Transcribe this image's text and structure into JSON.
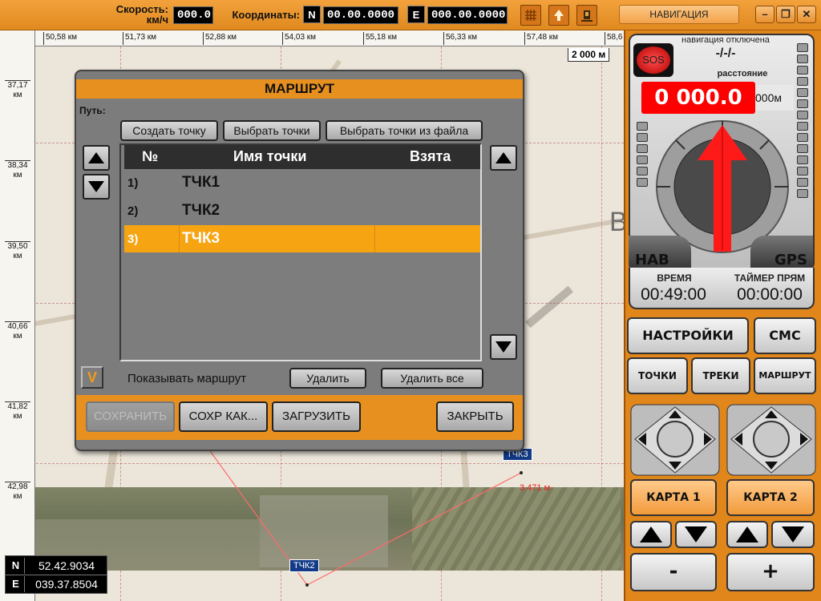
{
  "topbar": {
    "speed_label": "Скорость:",
    "speed_unit": "км/ч",
    "speed_value": "000.0",
    "coords_label": "Координаты:",
    "n_key": "N",
    "n_value": "00.00.0000",
    "e_key": "E",
    "e_value": "000.00.0000",
    "nav_tab": "НАВИГАЦИЯ"
  },
  "map": {
    "h_ticks": [
      "50,58 км",
      "51,73 км",
      "52,88 км",
      "54,03 км",
      "55,18 км",
      "56,33 км",
      "57,48 км",
      "58,6"
    ],
    "v_ticks": [
      {
        "top": "37,17",
        "bottom": "км"
      },
      {
        "top": "38,34",
        "bottom": "км"
      },
      {
        "top": "39,50",
        "bottom": "км"
      },
      {
        "top": "40,66",
        "bottom": "км"
      },
      {
        "top": "41,82",
        "bottom": "км"
      },
      {
        "top": "42,98",
        "bottom": "км"
      }
    ],
    "scale": "2 000 м",
    "marker1": "ТЧК3",
    "marker2": "ТЧК2",
    "distance": "3 471 м",
    "big_letter": "В",
    "n_key": "N",
    "n_value": "52.42.9034",
    "e_key": "E",
    "e_value": "039.37.8504"
  },
  "dialog": {
    "title": "МАРШРУТ",
    "path_label": "Путь:",
    "create_point": "Создать точку",
    "select_points": "Выбрать точки",
    "select_from_file": "Выбрать точки из файла",
    "col_num": "№",
    "col_name": "Имя точки",
    "col_taken": "Взята",
    "rows": [
      {
        "num": "1)",
        "name": "ТЧК1",
        "taken": ""
      },
      {
        "num": "2)",
        "name": "ТЧК2",
        "taken": ""
      },
      {
        "num": "3)",
        "name": "ТЧК3",
        "taken": ""
      }
    ],
    "show_route_check": "V",
    "show_route": "Показывать маршрут",
    "delete": "Удалить",
    "delete_all": "Удалить все",
    "save": "СОХРАНИТЬ",
    "save_as": "СОХР КАК...",
    "load": "ЗАГРУЗИТЬ",
    "close": "ЗАКРЫТЬ"
  },
  "panel": {
    "nav_status": "навигация отключена",
    "nav_value": "-/-/-",
    "sos": "SOS",
    "distance_label": "расстояние",
    "distance_value": "0 000.0",
    "distance_unit": "000м",
    "nav_btn": "НАВ",
    "gps_btn": "GPS",
    "time_label": "ВРЕМЯ",
    "time_value": "00:49:00",
    "timer_label": "ТАЙМЕР ПРЯМ",
    "timer_value": "00:00:00",
    "settings": "НАСТРОЙКИ",
    "sms": "СМС",
    "points": "ТОЧКИ",
    "tracks": "ТРЕКИ",
    "route": "МАРШРУТ",
    "map1": "КАРТА 1",
    "map2": "КАРТА 2",
    "zoom_out": "-",
    "zoom_in": "+"
  },
  "colors": {
    "accent": "#e8901f",
    "selected_row": "#f7a413",
    "distance_red": "#ff0000"
  }
}
